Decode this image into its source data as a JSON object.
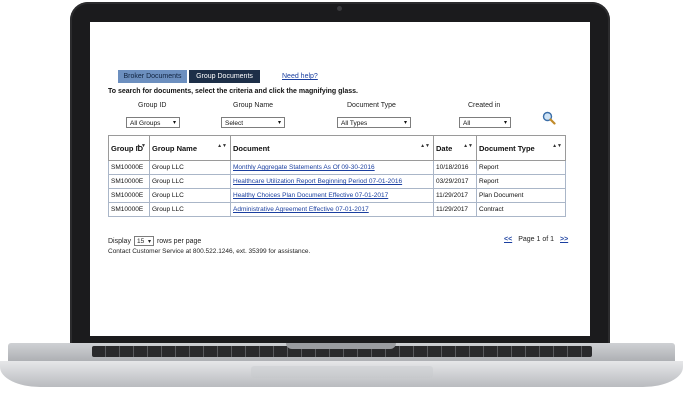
{
  "tabs": {
    "broker": "Broker Documents",
    "group": "Group Documents",
    "help": "Need help?"
  },
  "instructions": "To search for documents, select the criteria and click the magnifying glass.",
  "filters": {
    "group_id_label": "Group ID",
    "group_id_value": "All Groups",
    "group_name_label": "Group Name",
    "group_name_value": "Select",
    "doc_type_label": "Document Type",
    "doc_type_value": "All Types",
    "created_label": "Created in",
    "created_value": "All"
  },
  "table": {
    "headers": {
      "group_id": "Group ID",
      "group_name": "Group Name",
      "document": "Document",
      "date": "Date",
      "doc_type": "Document Type"
    },
    "rows": [
      {
        "group_id": "SM10000E",
        "group_name": "Group LLC",
        "document": "Monthly Aggregate Statements As Of 09-30-2016",
        "date": "10/18/2016",
        "doc_type": "Report"
      },
      {
        "group_id": "SM10000E",
        "group_name": "Group LLC",
        "document": "Healthcare Utilization Report Beginning Period 07-01-2016",
        "date": "03/29/2017",
        "doc_type": "Report"
      },
      {
        "group_id": "SM10000E",
        "group_name": "Group LLC",
        "document": "Healthy Choices Plan Document Effective 07-01-2017",
        "date": "11/29/2017",
        "doc_type": "Plan Document"
      },
      {
        "group_id": "SM10000E",
        "group_name": "Group LLC",
        "document": "Administrative Agreement Effective 07-01-2017",
        "date": "11/29/2017",
        "doc_type": "Contract"
      }
    ]
  },
  "footer": {
    "display_label": "Display",
    "per_page_value": "15",
    "rows_label": "rows per page",
    "prev": "<<",
    "page_text": "Page 1 of 1",
    "next": ">>",
    "contact": "Contact Customer Service at 800.522.1246, ext. 35399 for assistance."
  },
  "icons": {
    "search": "magnifying-glass-icon",
    "dropdown": "chevron-down-icon",
    "sort": "sort-arrows-icon"
  },
  "colors": {
    "tab_active": "#1d2f48",
    "tab_inactive": "#6c8fbf",
    "link": "#1a3fa0"
  }
}
